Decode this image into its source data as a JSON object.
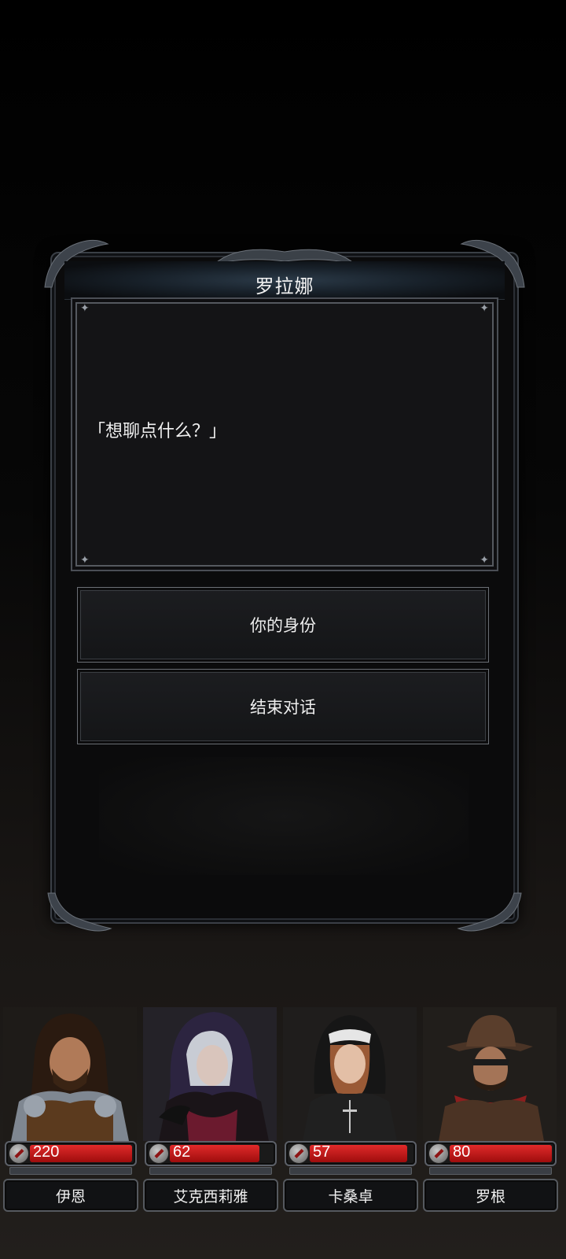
{
  "dialog": {
    "speaker": "罗拉娜",
    "text": "「想聊点什么？」",
    "choices": [
      {
        "label": "你的身份"
      },
      {
        "label": "结束对话"
      }
    ]
  },
  "party": [
    {
      "name": "伊恩",
      "hp": "220",
      "hp_fill": 1.0
    },
    {
      "name": "艾克西莉雅",
      "hp": "62",
      "hp_fill": 0.88
    },
    {
      "name": "卡桑卓",
      "hp": "57",
      "hp_fill": 0.95
    },
    {
      "name": "罗根",
      "hp": "80",
      "hp_fill": 1.0
    }
  ],
  "colors": {
    "hp_bar": "#c81c1c",
    "frame": "#3a3f46",
    "panel": "#141416"
  }
}
